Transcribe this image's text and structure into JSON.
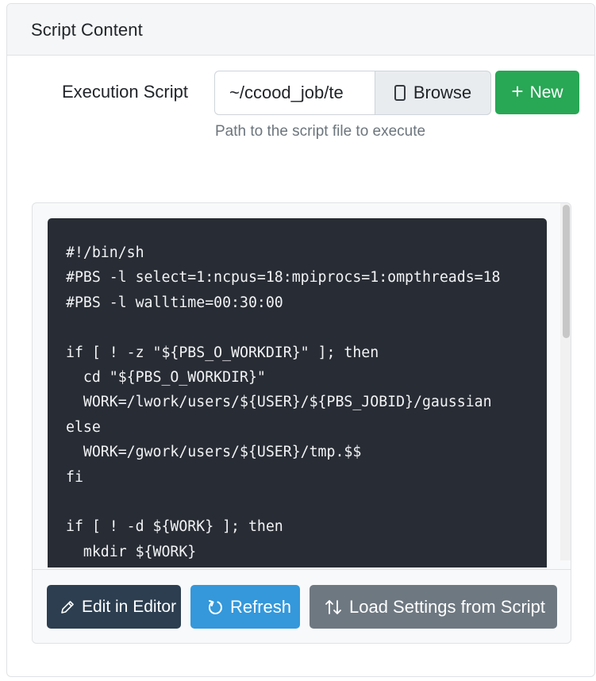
{
  "card": {
    "title": "Script Content"
  },
  "form": {
    "label": "Execution Script",
    "path_value": "~/ccood_job/te",
    "browse_label": "Browse",
    "new_label": "New",
    "help_text": "Path to the script file to execute"
  },
  "script": {
    "content": "#!/bin/sh\n#PBS -l select=1:ncpus=18:mpiprocs=1:ompthreads=18\n#PBS -l walltime=00:30:00\n\nif [ ! -z \"${PBS_O_WORKDIR}\" ]; then\n  cd \"${PBS_O_WORKDIR}\"\n  WORK=/lwork/users/${USER}/${PBS_JOBID}/gaussian\nelse\n  WORK=/gwork/users/${USER}/tmp.$$\nfi\n\nif [ ! -d ${WORK} ]; then\n  mkdir ${WORK}"
  },
  "actions": {
    "edit_label": "Edit in Editor",
    "refresh_label": "Refresh",
    "load_label": "Load Settings from Script"
  },
  "icons": {
    "browse": "file-icon",
    "new": "plus-icon",
    "edit": "pencil-icon",
    "refresh": "refresh-icon",
    "load": "sort-arrows-icon"
  },
  "colors": {
    "new_button": "#28a755",
    "edit_button": "#2c3e50",
    "refresh_button": "#3498db",
    "load_button": "#6e7881",
    "code_background": "#282c34"
  }
}
